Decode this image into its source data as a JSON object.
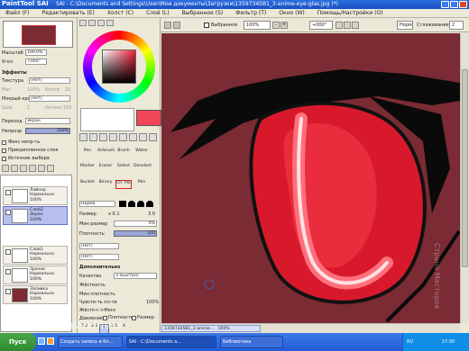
{
  "window": {
    "app_logo": "PaintTool SAI",
    "title": "SAI - C:\\Documents and Settings\\User\\Мои документы\\Загрузки\\13597345B1_3-anime-eye-glas.jpg (*)"
  },
  "menu": [
    "Файл (F)",
    "Редактировать (E)",
    "Холст (C)",
    "Слой (L)",
    "Выбранное (S)",
    "Фильтр (T)",
    "Окно (W)",
    "Помощь/Настройки (O)"
  ],
  "toolbar": {
    "selection_label": "Выбранное",
    "zoom": "100%",
    "rotation": "+000°",
    "stabilizer_mode": "Норм",
    "stabilizer_label": "Сглаживание",
    "stabilizer_value": "2"
  },
  "navigator": {
    "zoom_label": "Масштаб",
    "zoom_value": "100.0%",
    "angle_label": "Угол",
    "angle_value": "+000°"
  },
  "effects": {
    "header": "Эффекты",
    "texture_label": "Текстура",
    "texture_value": "[Нет]",
    "scale_label": "Мас",
    "scale_value": "100%",
    "strength_label": "Контр",
    "strength_value": "20",
    "edge_label": "Мокрый край",
    "edge_value": "[Нет]",
    "w_label": "Шир",
    "w_value": "1",
    "i_label": "Интенс",
    "i_value": "100"
  },
  "layer_props": {
    "mode_label": "Переход",
    "mode_value": "Экран",
    "opacity_label": "Непрозр",
    "opacity_value": "100%"
  },
  "checks": [
    "Фикс непр-ть",
    "Прикрепленное слоя",
    "Источник выбора"
  ],
  "layers": [
    {
      "name": "Лайнер",
      "mode": "Нормально",
      "opacity": "100%"
    },
    {
      "name": "Слой2",
      "mode": "Экран",
      "opacity": "100%"
    },
    {
      "name": "Слой1",
      "mode": "Нормально",
      "opacity": "100%"
    },
    {
      "name": "Зрачок",
      "mode": "Нормально",
      "opacity": "100%"
    },
    {
      "name": "Заливка",
      "mode": "Нормально",
      "opacity": "100%"
    }
  ],
  "tools_row": [
    "Pen",
    "Airbrush",
    "Brush",
    "Water"
  ],
  "tools_row2": [
    "Marker",
    "Eraser",
    "Select",
    "Deselect"
  ],
  "tools_row3": [
    "Bucket",
    "Binary",
    "Clr. Pen",
    "Pen"
  ],
  "brush": {
    "mode": "Норма",
    "size_label": "Размер",
    "size_mult": "x 0.1",
    "size_value": "3.0",
    "min_label": "Мин размер",
    "min_value": "0%",
    "density_label": "Плотность",
    "density_value": "100",
    "shape_value": "[Нет]",
    "shape2_value": "[Нет]",
    "adv_header": "Дополнительно",
    "quality_label": "Качество",
    "quality_value": "3 (Быстро)",
    "edge_label": "Жёсткость",
    "min_density_label": "Мин плотность",
    "sens_label": "Чувств-ть пл-ти",
    "sens_value": "100%",
    "hardness_label": "Жёстк<->Мягк",
    "pressure_label": "Давление:",
    "pressure_opts": [
      "Плотность",
      "Размер"
    ]
  },
  "sizes": [
    "2.2",
    "2.6",
    "3",
    "3.5",
    "4",
    "5",
    "6",
    "7",
    "8",
    "9"
  ],
  "status": {
    "file": "13597345B1_3-anime...",
    "zoom": "100%"
  },
  "taskbar": {
    "start": "Пуск",
    "tasks": [
      "Создать запись в бл...",
      "SAI - C:\\Documents a...",
      "Библиотека"
    ],
    "lang": "RU",
    "time": "17:30"
  },
  "watermark": {
    "left": "SummertimeSadness",
    "right": "Страна Мастеров"
  },
  "colors": {
    "primary": "#f0465a",
    "canvas_bg": "#7a2b33",
    "iris": "#d8192c"
  }
}
